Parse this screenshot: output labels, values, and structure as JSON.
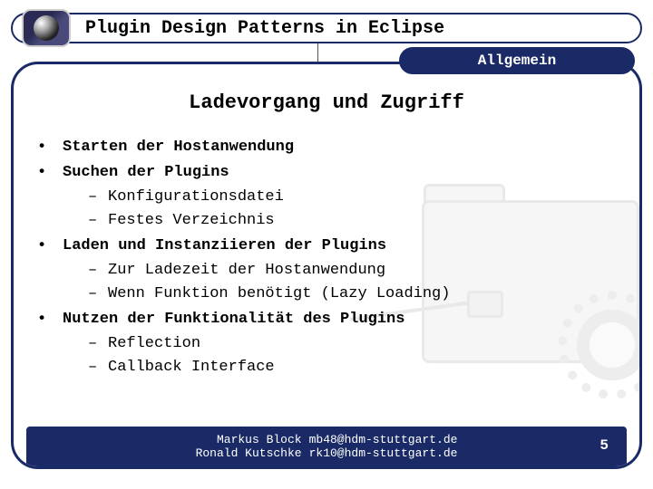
{
  "header": {
    "title": "Plugin Design Patterns in Eclipse"
  },
  "section": {
    "label": "Allgemein"
  },
  "slide": {
    "heading": "Ladevorgang und Zugriff",
    "bullets": [
      {
        "text": "Starten der Hostanwendung",
        "sub": []
      },
      {
        "text": "Suchen der Plugins",
        "sub": [
          "Konfigurationsdatei",
          "Festes Verzeichnis"
        ]
      },
      {
        "text": "Laden und Instanziieren der Plugins",
        "sub": [
          "Zur Ladezeit der Hostanwendung",
          "Wenn Funktion benötigt (Lazy Loading)"
        ]
      },
      {
        "text": "Nutzen der Funktionalität des Plugins",
        "sub": [
          "Reflection",
          "Callback Interface"
        ]
      }
    ]
  },
  "footer": {
    "author1_name": "Markus Block",
    "author1_email": "mb48@hdm-stuttgart.de",
    "author2_name": "Ronald Kutschke",
    "author2_email": "rk10@hdm-stuttgart.de",
    "page": "5"
  }
}
